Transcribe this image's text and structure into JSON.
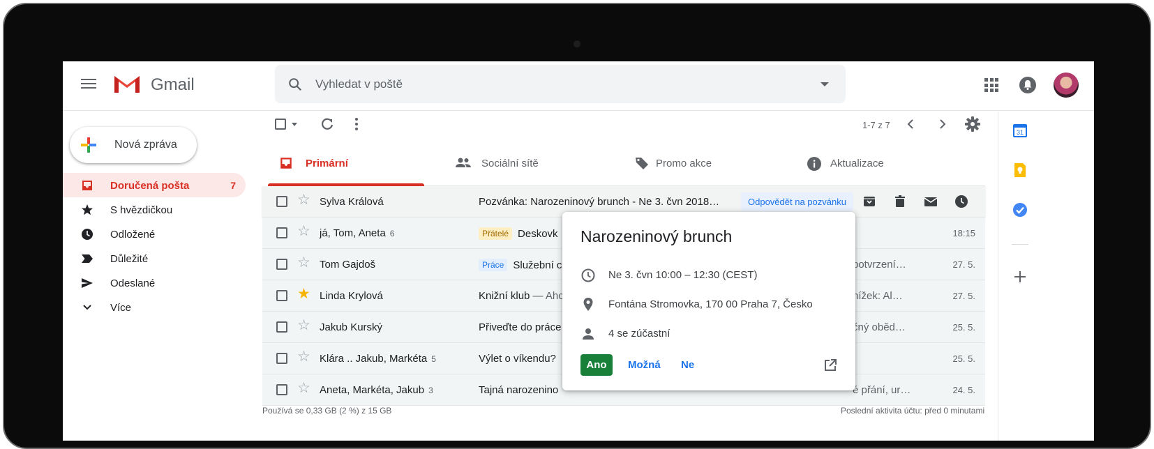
{
  "header": {
    "brand": "Gmail",
    "search_placeholder": "Vyhledat v poště"
  },
  "compose": {
    "label": "Nová zpráva"
  },
  "nav": {
    "items": [
      {
        "label": "Doručená pošta",
        "count": "7",
        "icon": "inbox-icon"
      },
      {
        "label": "S hvězdičkou",
        "icon": "star-icon"
      },
      {
        "label": "Odložené",
        "icon": "clock-icon"
      },
      {
        "label": "Důležité",
        "icon": "important-icon"
      },
      {
        "label": "Odeslané",
        "icon": "send-icon"
      },
      {
        "label": "Více",
        "icon": "chevron-down-icon"
      }
    ]
  },
  "toolbar": {
    "pager": "1-7 z 7"
  },
  "tabs": [
    {
      "label": "Primární",
      "icon": "inbox-icon"
    },
    {
      "label": "Sociální sítě",
      "icon": "people-icon"
    },
    {
      "label": "Promo akce",
      "icon": "tag-icon"
    },
    {
      "label": "Aktualizace",
      "icon": "info-icon"
    }
  ],
  "emails": [
    {
      "sender": "Sylva Králová",
      "thread": "",
      "subject": "Pozvánka: Narozeninový brunch - Ne 3. čvn 2018…",
      "action": "Odpovědět na pozvánku",
      "starred": false
    },
    {
      "sender": "já, Tom, Aneta",
      "thread": "6",
      "chip": "Přátelé",
      "subject": "Deskovk",
      "tail": "",
      "date": "18:15",
      "starred": false
    },
    {
      "sender": "Tom Gajdoš",
      "thread": "",
      "chip": "Práce",
      "subject": "Služební c",
      "tail": "potvrzení…",
      "date": "27. 5.",
      "starred": false
    },
    {
      "sender": "Linda Krylová",
      "thread": "",
      "subject": "Knižní klub",
      "snippet": " — Ahc",
      "tail": "nížek: Al…",
      "date": "27. 5.",
      "starred": true
    },
    {
      "sender": "Jakub Kurský",
      "thread": "",
      "subject": "Přiveďte do práce",
      "tail": "čný oběd…",
      "date": "25. 5.",
      "starred": false
    },
    {
      "sender": "Klára .. Jakub, Markéta",
      "thread": "5",
      "subject": "Výlet o víkendu?",
      "tail": "",
      "date": "25. 5.",
      "starred": false
    },
    {
      "sender": "Aneta, Markéta, Jakub",
      "thread": "3",
      "subject": "Tajná narozenino",
      "tail": "é přání, ur…",
      "date": "24. 5.",
      "starred": false
    }
  ],
  "footer": {
    "storage": "Používá se 0,33 GB (2 %) z 15 GB",
    "activity": "Poslední aktivita účtu: před 0 minutami"
  },
  "event": {
    "title": "Narozeninový brunch",
    "time": "Ne 3. čvn 10:00 – 12:30 (CEST)",
    "location": "Fontána Stromovka, 170 00 Praha 7, Česko",
    "attendees": "4 se zúčastní",
    "yes": "Ano",
    "maybe": "Možná",
    "no": "Ne"
  },
  "rail": {
    "calendar_day": "31"
  },
  "colors": {
    "accent": "#d93025",
    "link": "#1a73e8",
    "yes": "#188038"
  }
}
